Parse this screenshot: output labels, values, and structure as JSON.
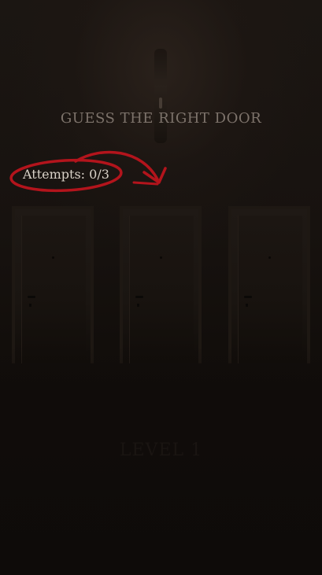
{
  "game": {
    "title": "GUESS THE RIGHT DOOR",
    "attempts_label": "Attempts: 0/3",
    "level_label": "LEVEL 1"
  },
  "doors": [
    {
      "label": ""
    },
    {
      "label": ""
    },
    {
      "label": ""
    }
  ],
  "colors": {
    "background": "#0f0b09",
    "title": "#7d736b",
    "attempts_text": "#d9d2c8",
    "annotation_red": "#b3141c",
    "door": "#1c1612"
  }
}
